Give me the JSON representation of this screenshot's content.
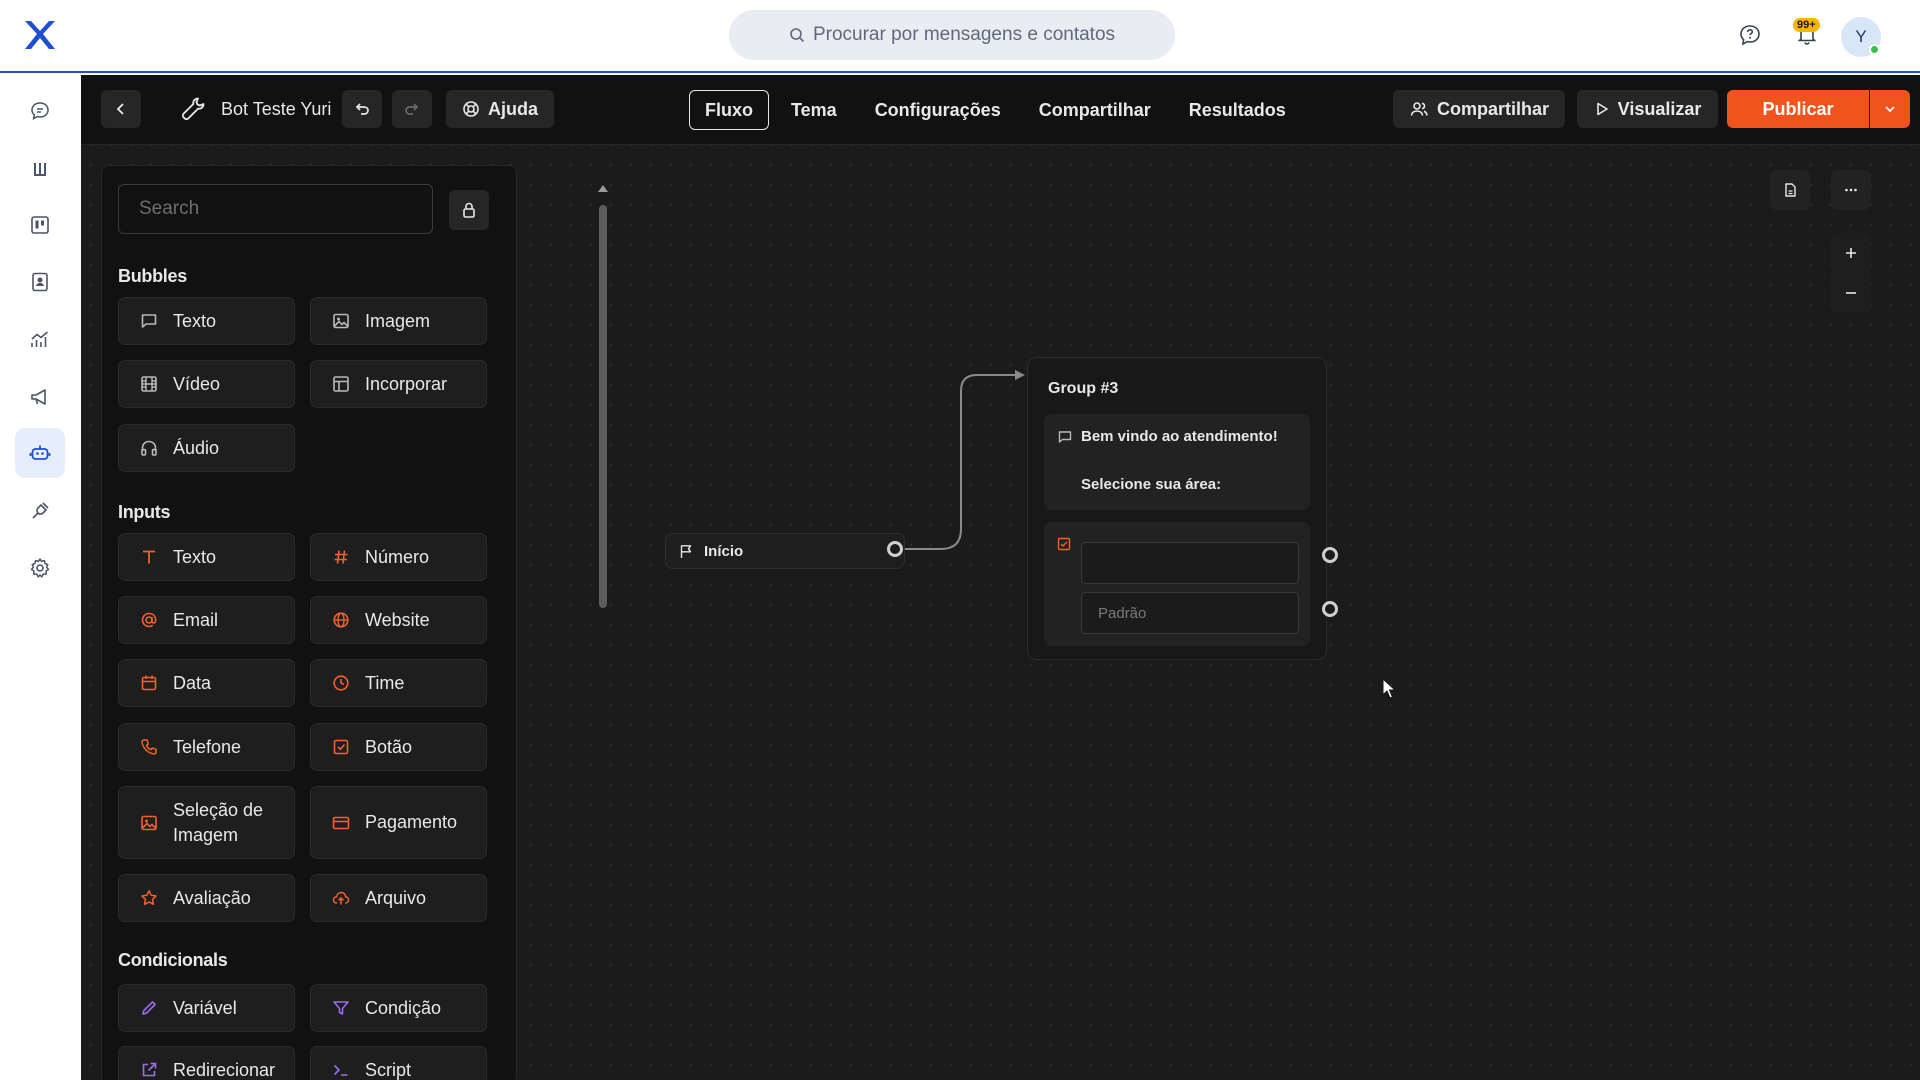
{
  "topbar": {
    "search_placeholder": "Procurar por mensagens e contatos",
    "notification_badge": "99+",
    "avatar_initial": "Y"
  },
  "editor_header": {
    "bot_name": "Bot Teste Yuri",
    "help_label": "Ajuda",
    "tabs": [
      {
        "label": "Fluxo",
        "active": true
      },
      {
        "label": "Tema",
        "active": false
      },
      {
        "label": "Configurações",
        "active": false
      },
      {
        "label": "Compartilhar",
        "active": false
      },
      {
        "label": "Resultados",
        "active": false
      }
    ],
    "share_label": "Compartilhar",
    "preview_label": "Visualizar",
    "publish_label": "Publicar"
  },
  "blocks_panel": {
    "search_placeholder": "Search",
    "sections": {
      "bubbles": "Bubbles",
      "inputs": "Inputs",
      "conditionals": "Condicionals"
    },
    "bubbles": [
      "Texto",
      "Imagem",
      "Vídeo",
      "Incorporar",
      "Áudio"
    ],
    "inputs": [
      "Texto",
      "Número",
      "Email",
      "Website",
      "Data",
      "Time",
      "Telefone",
      "Botão",
      "Seleção de Imagem",
      "Pagamento",
      "Avaliação",
      "Arquivo"
    ],
    "conditionals": [
      "Variável",
      "Condição",
      "Redirecionar",
      "Script"
    ]
  },
  "canvas": {
    "start_node_label": "Início",
    "group": {
      "title": "Group #3",
      "text_line_1": "Bem vindo ao atendimento!",
      "text_line_2": "Selecione sua área:",
      "button_item_value": "",
      "default_item_label": "Padrão"
    }
  },
  "colors": {
    "accent_orange": "#f1531c",
    "brand_blue": "#1f4fd1",
    "bubble_icon": "#b9b9b9",
    "input_icon": "#f1612a",
    "conditional_icon": "#9b6cf0"
  }
}
